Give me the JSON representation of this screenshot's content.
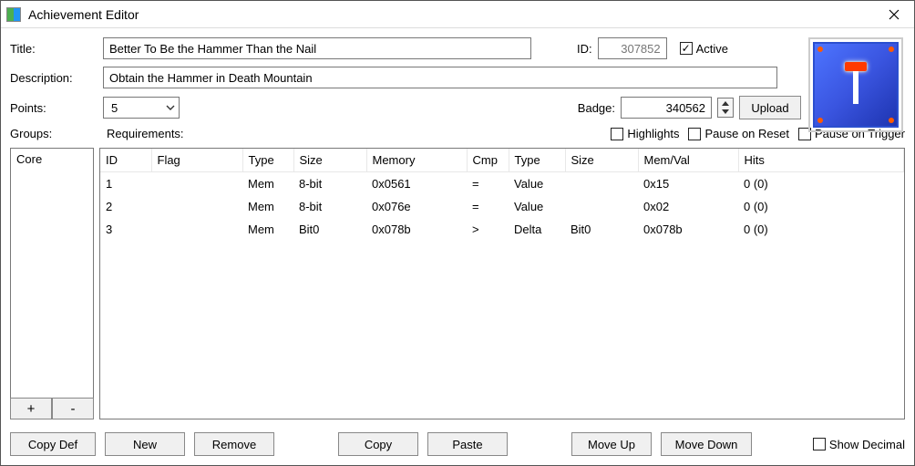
{
  "window": {
    "title": "Achievement Editor"
  },
  "labels": {
    "title": "Title:",
    "description": "Description:",
    "points": "Points:",
    "id": "ID:",
    "active": "Active",
    "badge": "Badge:",
    "groups": "Groups:",
    "requirements": "Requirements:",
    "highlights": "Highlights",
    "pause_reset": "Pause on Reset",
    "pause_trigger": "Pause on Trigger",
    "show_decimal": "Show Decimal"
  },
  "values": {
    "title": "Better To Be the Hammer Than the Nail",
    "description": "Obtain the Hammer in Death Mountain",
    "points": "5",
    "id": "307852",
    "active": true,
    "badge": "340562"
  },
  "buttons": {
    "upload": "Upload",
    "plus": "+",
    "minus": "-",
    "copydef": "Copy Def",
    "new": "New",
    "remove": "Remove",
    "copy": "Copy",
    "paste": "Paste",
    "moveup": "Move Up",
    "movedown": "Move Down"
  },
  "groups": {
    "items": [
      "Core"
    ]
  },
  "columns": {
    "id": "ID",
    "flag": "Flag",
    "type1": "Type",
    "size1": "Size",
    "memory": "Memory",
    "cmp": "Cmp",
    "type2": "Type",
    "size2": "Size",
    "memval": "Mem/Val",
    "hits": "Hits"
  },
  "rows": [
    {
      "id": "1",
      "flag": "",
      "type1": "Mem",
      "size1": "8-bit",
      "memory": "0x0561",
      "cmp": "=",
      "type2": "Value",
      "size2": "",
      "memval": "0x15",
      "hits": "0 (0)"
    },
    {
      "id": "2",
      "flag": "",
      "type1": "Mem",
      "size1": "8-bit",
      "memory": "0x076e",
      "cmp": "=",
      "type2": "Value",
      "size2": "",
      "memval": "0x02",
      "hits": "0 (0)"
    },
    {
      "id": "3",
      "flag": "",
      "type1": "Mem",
      "size1": "Bit0",
      "memory": "0x078b",
      "cmp": ">",
      "type2": "Delta",
      "size2": "Bit0",
      "memval": "0x078b",
      "hits": "0 (0)"
    }
  ],
  "colors": {
    "badge_bg": "#3a55e0",
    "accent": "#ff3a00"
  }
}
